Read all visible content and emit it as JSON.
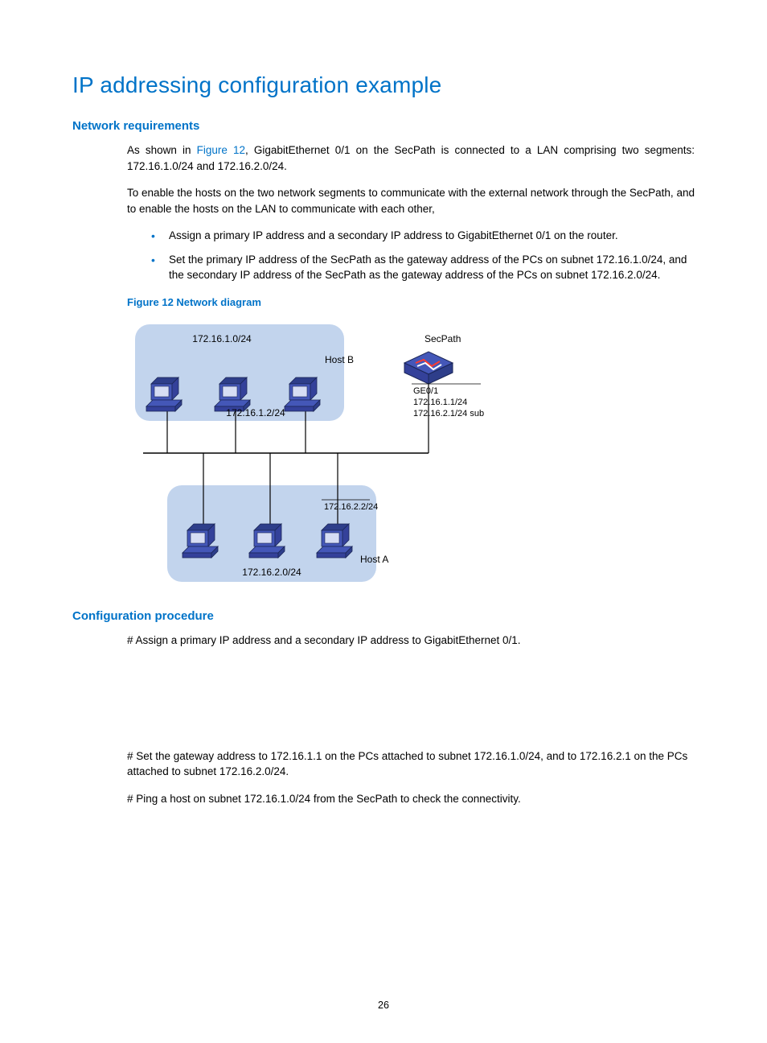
{
  "title": "IP addressing configuration example",
  "sections": {
    "req": {
      "heading": "Network requirements",
      "p1_pre": "As shown in ",
      "p1_link": "Figure 12",
      "p1_post": ", GigabitEthernet 0/1 on the SecPath is connected to a LAN comprising two segments: 172.16.1.0/24 and 172.16.2.0/24.",
      "p2": "To enable the hosts on the two network segments to communicate with the external network through the SecPath, and to enable the hosts on the LAN to communicate with each other,",
      "b1": "Assign a primary IP address and a secondary IP address to GigabitEthernet 0/1 on the router.",
      "b2": "Set the primary IP address of the SecPath as the gateway address of the PCs on subnet 172.16.1.0/24, and the secondary IP address of the SecPath as the gateway address of the PCs on subnet 172.16.2.0/24."
    },
    "figure": {
      "caption": "Figure 12 Network diagram",
      "labels": {
        "subnet1": "172.16.1.0/24",
        "hostB": "Host B",
        "ipB": "172.16.1.2/24",
        "secpath": "SecPath",
        "ge": "GE0/1",
        "ip1": "172.16.1.1/24",
        "ip2": "172.16.2.1/24 sub",
        "ipA": "172.16.2.2/24",
        "subnet2": "172.16.2.0/24",
        "hostA": "Host A"
      }
    },
    "proc": {
      "heading": "Configuration procedure",
      "p1": "# Assign a primary IP address and a secondary IP address to GigabitEthernet 0/1.",
      "p2": "# Set the gateway address to 172.16.1.1 on the PCs attached to subnet 172.16.1.0/24, and to 172.16.2.1 on the PCs attached to subnet 172.16.2.0/24.",
      "p3": "# Ping a host on subnet 172.16.1.0/24 from the SecPath to check the connectivity."
    }
  },
  "page_number": "26"
}
